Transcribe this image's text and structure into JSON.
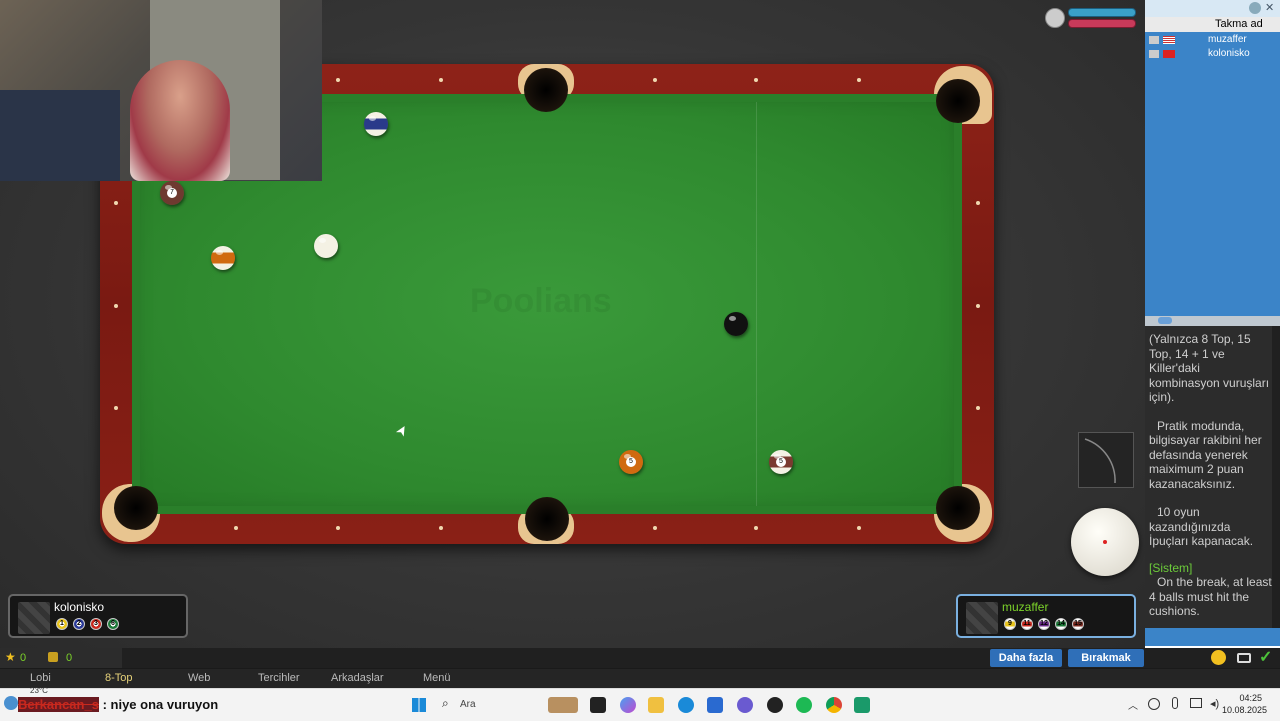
{
  "game": {
    "logo": "Poolians",
    "cursor": "➤"
  },
  "balls": [
    {
      "id": "ball-10",
      "color": "#2a3a8a",
      "stripe": true,
      "label": ""
    },
    {
      "id": "ball-7",
      "color": "#6e3a30",
      "stripe": false,
      "label": "7"
    },
    {
      "id": "ball-13",
      "color": "#d06a10",
      "stripe": true,
      "label": ""
    },
    {
      "id": "cue",
      "color": "#f4f1e4",
      "stripe": false,
      "label": ""
    },
    {
      "id": "ball-8",
      "color": "#111111",
      "stripe": false,
      "label": ""
    },
    {
      "id": "ball-5",
      "color": "#d06a10",
      "stripe": false,
      "label": "5"
    },
    {
      "id": "ball-15",
      "color": "#7a3a30",
      "stripe": true,
      "label": "5"
    }
  ],
  "players": {
    "left": {
      "name": "kolonisko",
      "balls": [
        {
          "n": "1",
          "color": "#e8c31a"
        },
        {
          "n": "2",
          "color": "#2a3a9a"
        },
        {
          "n": "3",
          "color": "#c8281e"
        },
        {
          "n": "6",
          "color": "#1e7a3a"
        }
      ]
    },
    "right": {
      "name": "muzaffer",
      "balls": [
        {
          "n": "9",
          "color": "#e8c31a"
        },
        {
          "n": "11",
          "color": "#c8281e"
        },
        {
          "n": "12",
          "color": "#6a2a8a"
        },
        {
          "n": "14",
          "color": "#1e7a3a"
        },
        {
          "n": "15",
          "color": "#7a2a20"
        }
      ]
    }
  },
  "sidebar": {
    "column_header": "Takma ad",
    "users": [
      {
        "name": "muzaffer",
        "flag": "us"
      },
      {
        "name": "kolonisko",
        "flag": "tr"
      }
    ],
    "chat": {
      "p1": "(Yalnızca 8 Top, 15 Top, 14 + 1 ve Killer'daki kombinasyon vuruşları için).",
      "p2": "Pratik modunda, bilgisayar rakibini her defasında yenerek maiximum 2 puan kazanacaksınız.",
      "p3": "10 oyun kazandığınızda İpuçları kapanacak.",
      "system_tag": "[Sistem]",
      "system_msg": "On the break, at least 4 balls must hit the cushions."
    }
  },
  "bottom": {
    "stars": "0",
    "coins": "0",
    "more_button": "Daha fazla",
    "leave_button": "Bırakmak"
  },
  "menu": [
    "Lobi",
    "8-Top",
    "Web",
    "Tercihler",
    "Arkadaşlar",
    "Menü"
  ],
  "overlay": {
    "username": "Berkancan_s",
    "message": ": niye ona vuruyon",
    "temp": "23°C"
  },
  "taskbar": {
    "search_placeholder": "Ara",
    "time": "04:25",
    "date": "10.08.2025"
  },
  "colors": {
    "felt": "#2f8a2f",
    "rail": "#7a1a12",
    "accent": "#2f6fb8"
  }
}
